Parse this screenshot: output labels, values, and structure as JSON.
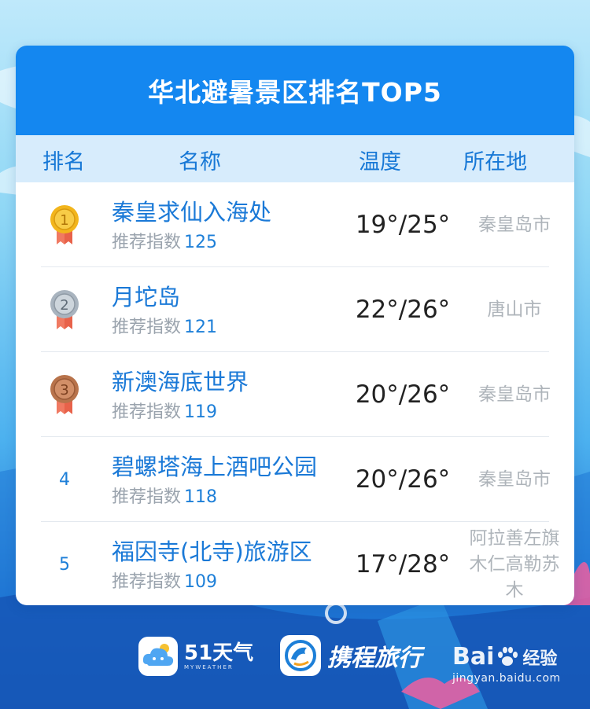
{
  "title": "华北避暑景区排名TOP5",
  "columns": {
    "rank": "排名",
    "name": "名称",
    "temp": "温度",
    "place": "所在地"
  },
  "index_label": "推荐指数",
  "rows": [
    {
      "rank": "1",
      "medal": "gold-medal-icon",
      "name": "秦皇求仙入海处",
      "index": "125",
      "temp": "19°/25°",
      "place": "秦皇岛市"
    },
    {
      "rank": "2",
      "medal": "silver-medal-icon",
      "name": "月坨岛",
      "index": "121",
      "temp": "22°/26°",
      "place": "唐山市"
    },
    {
      "rank": "3",
      "medal": "bronze-medal-icon",
      "name": "新澳海底世界",
      "index": "119",
      "temp": "20°/26°",
      "place": "秦皇岛市"
    },
    {
      "rank": "4",
      "name": "碧螺塔海上酒吧公园",
      "index": "118",
      "temp": "20°/26°",
      "place": "秦皇岛市"
    },
    {
      "rank": "5",
      "name": "福因寺(北寺)旅游区",
      "index": "109",
      "temp": "17°/28°",
      "place": "阿拉善左旗木仁高勒苏木"
    }
  ],
  "footer": {
    "weather_logo_main": "51天气",
    "weather_logo_sub": "MYWEATHER",
    "ctrip_logo": "携程旅行"
  },
  "watermark": {
    "brand": "Bai",
    "brand2": "经验",
    "url": "jingyan.baidu.com"
  },
  "colors": {
    "header_blue": "#1487f0",
    "column_header_bg": "#d7ecfc",
    "accent_blue": "#1a79d7",
    "gold": "#f2b51c",
    "silver": "#a9b4bf",
    "bronze": "#b8734b",
    "ribbon": "#f07a62"
  }
}
